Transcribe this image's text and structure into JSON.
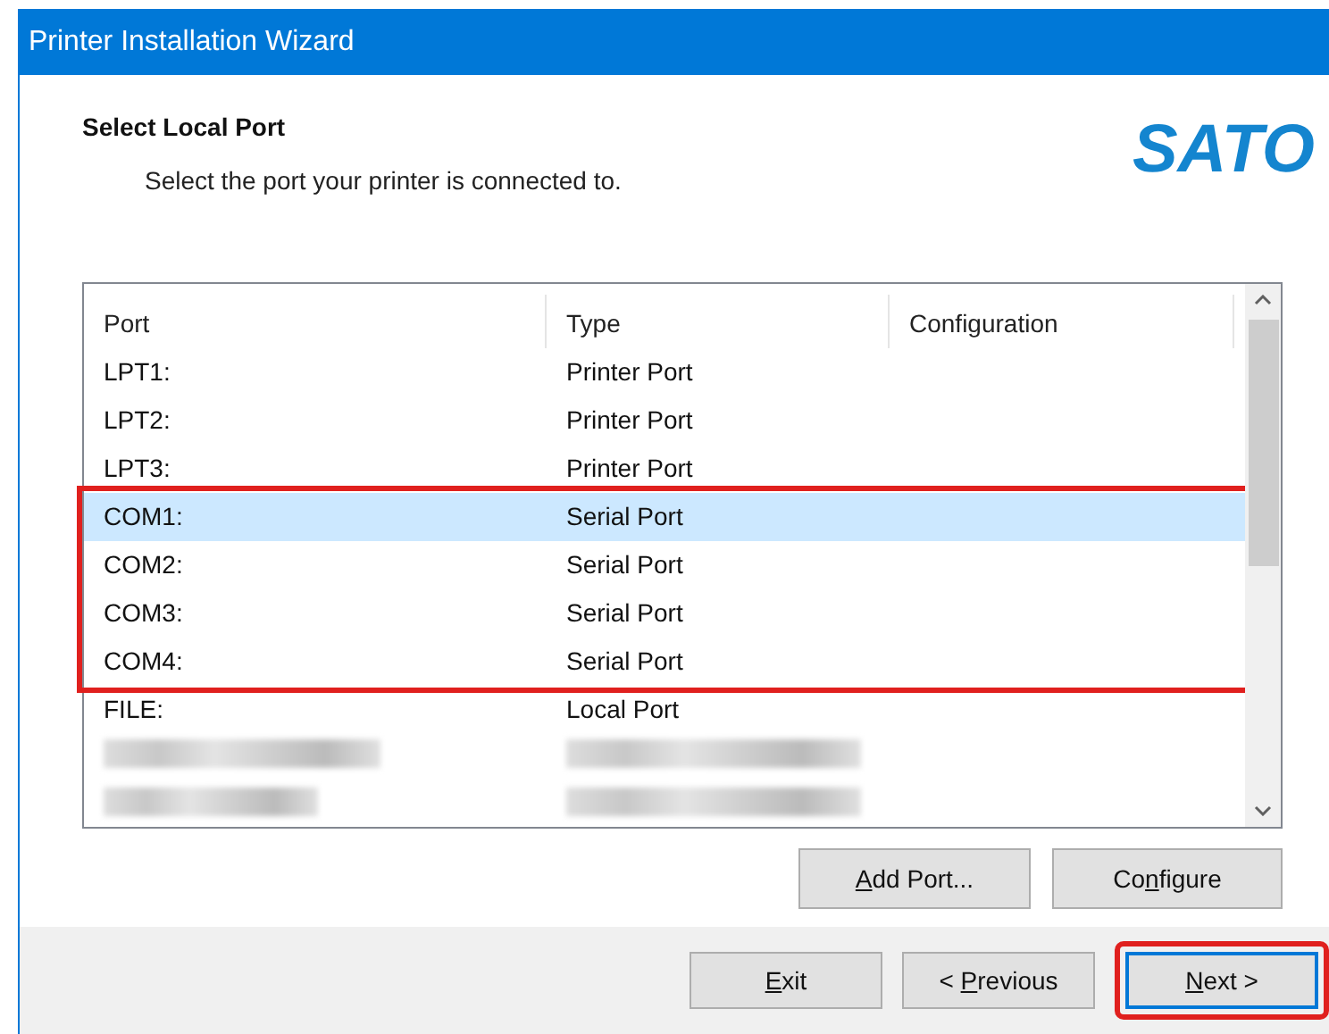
{
  "window": {
    "title": "Printer Installation Wizard"
  },
  "header": {
    "title": "Select Local Port",
    "subtitle": "Select the port your printer is connected to.",
    "logo": "SATO"
  },
  "table": {
    "columns": [
      "Port",
      "Type",
      "Configuration"
    ],
    "rows": [
      {
        "kind": "port",
        "port": "LPT1:",
        "type": "Printer Port",
        "selected": false,
        "highlighted": false
      },
      {
        "kind": "port",
        "port": "LPT2:",
        "type": "Printer Port",
        "selected": false,
        "highlighted": false
      },
      {
        "kind": "port",
        "port": "LPT3:",
        "type": "Printer Port",
        "selected": false,
        "highlighted": false
      },
      {
        "kind": "port",
        "port": "COM1:",
        "type": "Serial Port",
        "selected": true,
        "highlighted": true
      },
      {
        "kind": "port",
        "port": "COM2:",
        "type": "Serial Port",
        "selected": false,
        "highlighted": true
      },
      {
        "kind": "port",
        "port": "COM3:",
        "type": "Serial Port",
        "selected": false,
        "highlighted": true
      },
      {
        "kind": "port",
        "port": "COM4:",
        "type": "Serial Port",
        "selected": false,
        "highlighted": true
      },
      {
        "kind": "port",
        "port": "FILE:",
        "type": "Local Port",
        "selected": false,
        "highlighted": false
      },
      {
        "kind": "redacted",
        "selected": false,
        "highlighted": false
      },
      {
        "kind": "redacted",
        "selected": false,
        "highlighted": false
      }
    ]
  },
  "list_buttons": [
    {
      "access_key": "A",
      "after": "dd Port..."
    },
    {
      "before": "Co",
      "access_key": "n",
      "after": "figure"
    }
  ],
  "footer_buttons": [
    {
      "access_key": "E",
      "after": "xit",
      "default": false,
      "highlighted": false
    },
    {
      "before": "< ",
      "access_key": "P",
      "after": "revious",
      "default": false,
      "highlighted": false
    },
    {
      "access_key": "N",
      "after": "ext >",
      "default": true,
      "highlighted": true
    }
  ]
}
